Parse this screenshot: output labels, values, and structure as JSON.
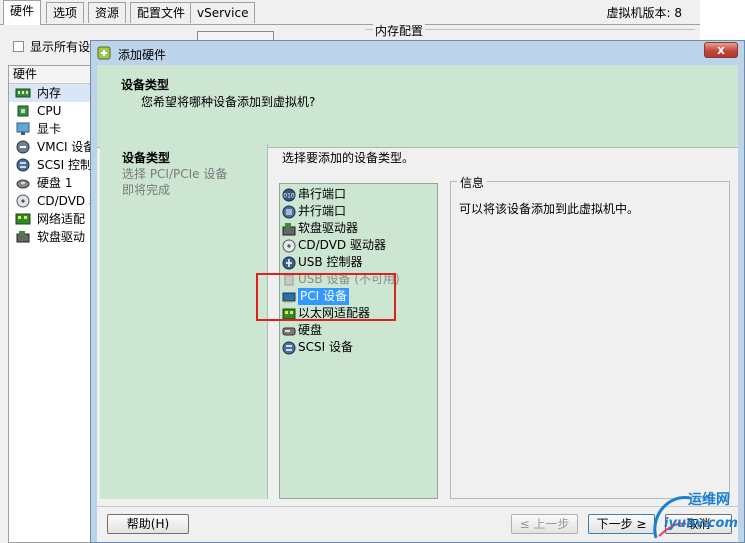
{
  "background_window": {
    "tabs": [
      "硬件",
      "选项",
      "资源",
      "配置文件",
      "vService"
    ],
    "vm_version": "虚拟机版本: 8",
    "show_all_label": "显示所有设",
    "memory_group_title": "内存配置",
    "hardware_header": "硬件",
    "hardware_items": [
      {
        "label": "内存",
        "icon": "memory-icon"
      },
      {
        "label": "CPU",
        "icon": "cpu-icon"
      },
      {
        "label": "显卡",
        "icon": "display-icon"
      },
      {
        "label": "VMCI 设备",
        "icon": "vmci-icon"
      },
      {
        "label": "SCSI 控制",
        "icon": "scsi-icon"
      },
      {
        "label": "硬盘 1",
        "icon": "disk-icon"
      },
      {
        "label": "CD/DVD 驱",
        "icon": "cdrom-icon"
      },
      {
        "label": "网络适配",
        "icon": "network-icon"
      },
      {
        "label": "软盘驱动",
        "icon": "floppy-icon"
      }
    ]
  },
  "dialog": {
    "title": "添加硬件",
    "close_label": "x",
    "header_title": "设备类型",
    "header_subtitle": "您希望将哪种设备添加到虚拟机?",
    "steps": [
      "设备类型",
      "选择 PCI/PCIe 设备",
      "即将完成"
    ],
    "prompt": "选择要添加的设备类型。",
    "devices": [
      {
        "label": "串行端口",
        "icon": "serial-port-icon"
      },
      {
        "label": "并行端口",
        "icon": "parallel-port-icon"
      },
      {
        "label": "软盘驱动器",
        "icon": "floppy-icon"
      },
      {
        "label": "CD/DVD 驱动器",
        "icon": "cdrom-icon"
      },
      {
        "label": "USB 控制器",
        "icon": "usb-icon"
      },
      {
        "label": "USB 设备 (不可用)",
        "icon": "usb-device-icon"
      },
      {
        "label": "PCI 设备",
        "icon": "pci-icon"
      },
      {
        "label": "以太网适配器",
        "icon": "network-icon"
      },
      {
        "label": "硬盘",
        "icon": "disk-icon"
      },
      {
        "label": "SCSI 设备",
        "icon": "scsi-icon"
      }
    ],
    "selected_device": "PCI 设备",
    "info_title": "信息",
    "info_text": "可以将该设备添加到此虚拟机中。",
    "buttons": {
      "help": "帮助(H)",
      "back": "≤ 上一步",
      "next": "下一步 ≥",
      "cancel": "取消"
    }
  },
  "watermark": {
    "line1": "运维网",
    "line2": "iyunv.com"
  },
  "colors": {
    "wizard_green": "#cce6d2",
    "selection_blue": "#3399ff",
    "annotation_red": "#e02020"
  }
}
